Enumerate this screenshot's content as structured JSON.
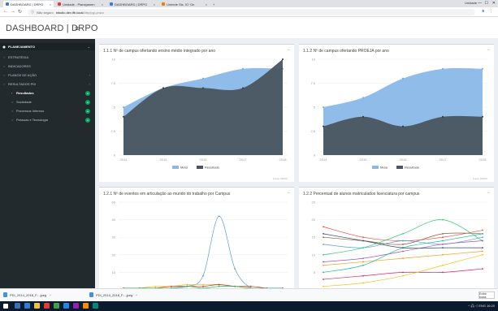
{
  "browser": {
    "tabs": [
      {
        "label": "DASHBOARD | DRPO",
        "color": "#3b78e7"
      },
      {
        "label": "Unidade - Planejamen",
        "color": "#e53935"
      },
      {
        "label": "DASHBOARD | DRPO",
        "color": "#3b78e7"
      },
      {
        "label": "Unirede Sis. IO 'On",
        "color": "#f57c00"
      }
    ],
    "profile": "Unidade",
    "window_controls": [
      "—",
      "☐",
      "✕"
    ],
    "address": {
      "secure_label": "Não seguro",
      "host": "intudio.dev.ifb.local",
      "path": "/dtrp/pgi-pracv"
    }
  },
  "header": {
    "brand": "DASHBOARD | DRPO",
    "menu_icon": "hamburger-icon"
  },
  "sidebar": {
    "main": "PLANEJAMENTO",
    "items": [
      {
        "label": "ESTRATÉGIA"
      },
      {
        "label": "INDICADORES"
      },
      {
        "label": "PLANOS DE AÇÃO"
      },
      {
        "label": "RESULTADOS PDI"
      }
    ],
    "subitems": [
      {
        "label": "Resultados",
        "active": true
      },
      {
        "label": "Sociedade",
        "active": false
      },
      {
        "label": "Processos Internos",
        "active": false
      },
      {
        "label": "Pessoas e Tecnologia",
        "active": false
      }
    ]
  },
  "panels": {
    "p1": {
      "title": "1.1.1 Nº de campus ofertando ensino médio integrado por ano",
      "source": "Fonte: DPRO"
    },
    "p2": {
      "title": "1.1.2 Nº de campus ofertando PROEJA por ano",
      "source": "Fonte: DPRO"
    },
    "p3": {
      "title": "1.2.1 Nº de eventos em articulação ao mundo do trabalho por Campus"
    },
    "p4": {
      "title": "1.2.2 Percentual de alunos matriculados licenciatura por campus"
    },
    "minimize": "−"
  },
  "chart_data": [
    {
      "type": "area",
      "x": [
        "2014",
        "2015",
        "2016",
        "2017",
        "2018"
      ],
      "ylim": [
        0,
        10
      ],
      "yticks": [
        "0",
        "2.5",
        "5",
        "7.5",
        "10"
      ],
      "series": [
        {
          "name": "Meta",
          "values": [
            5,
            7,
            8,
            9,
            9
          ],
          "color": "#8ab8e8"
        },
        {
          "name": "Resultado",
          "values": [
            4,
            7,
            7,
            7,
            10
          ],
          "color": "#4a5560"
        }
      ],
      "legend": "bottom-center"
    },
    {
      "type": "area",
      "x": [
        "2014",
        "2015",
        "2016",
        "2017",
        "2018"
      ],
      "ylim": [
        0,
        10
      ],
      "yticks": [
        "0",
        "2.5",
        "5",
        "7.5",
        "10"
      ],
      "series": [
        {
          "name": "Meta",
          "values": [
            5,
            6,
            8,
            9,
            9
          ],
          "color": "#8ab8e8"
        },
        {
          "name": "Resultado",
          "values": [
            3,
            4,
            3,
            4,
            4
          ],
          "color": "#4a5560"
        }
      ],
      "legend": "bottom-center"
    },
    {
      "type": "line",
      "ylim": [
        0,
        50
      ],
      "yticks": [
        "10",
        "20",
        "30",
        "40",
        "50"
      ],
      "x": [
        0,
        1,
        2,
        3,
        4,
        5,
        6,
        7,
        8,
        9,
        10
      ],
      "series": [
        {
          "values": [
            0,
            0,
            0,
            1,
            2,
            8,
            42,
            12,
            1,
            0,
            0
          ],
          "color": "#5b9bd5"
        },
        {
          "values": [
            1,
            1,
            2,
            2,
            3,
            3,
            3,
            2,
            1,
            1,
            1
          ],
          "color": "#f1c40f"
        },
        {
          "values": [
            0,
            1,
            1,
            2,
            2,
            2,
            3,
            2,
            2,
            1,
            1
          ],
          "color": "#c0392b"
        },
        {
          "values": [
            1,
            1,
            1,
            1,
            2,
            1,
            2,
            2,
            1,
            1,
            1
          ],
          "color": "#27ae60"
        }
      ]
    },
    {
      "type": "line",
      "ylim": [
        0,
        25
      ],
      "yticks": [
        "5",
        "10",
        "15",
        "20",
        "25"
      ],
      "x": [
        0,
        1,
        2,
        3,
        4
      ],
      "series": [
        {
          "values": [
            18,
            15,
            14,
            15,
            17
          ],
          "color": "#e74c3c"
        },
        {
          "values": [
            15,
            14,
            13,
            16,
            16
          ],
          "color": "#8e5a3c"
        },
        {
          "values": [
            13,
            12,
            14,
            13,
            15
          ],
          "color": "#5b9bd5"
        },
        {
          "values": [
            10,
            12,
            16,
            20,
            14
          ],
          "color": "#2ecc71"
        },
        {
          "values": [
            8,
            9,
            11,
            13,
            14
          ],
          "color": "#9b59b6"
        },
        {
          "values": [
            7,
            8,
            9,
            10,
            11
          ],
          "color": "#f39c12"
        },
        {
          "values": [
            5,
            7,
            12,
            14,
            16
          ],
          "color": "#1abc9c"
        },
        {
          "values": [
            3,
            4,
            5,
            5,
            6
          ],
          "color": "#e91e63"
        },
        {
          "values": [
            1,
            2,
            4,
            7,
            10
          ],
          "color": "#f1c40f"
        },
        {
          "values": [
            16,
            14,
            12,
            12,
            12
          ],
          "color": "#34495e"
        }
      ]
    }
  ],
  "downloads": {
    "items": [
      {
        "label": "PDI_2014_2018_F....jpeg"
      },
      {
        "label": "PDI_2014_2018_F....jpeg"
      }
    ],
    "show_all": "Exibir todos"
  },
  "taskbar": {
    "tray": "^ 🖧 ◁ ENG 16:20"
  }
}
